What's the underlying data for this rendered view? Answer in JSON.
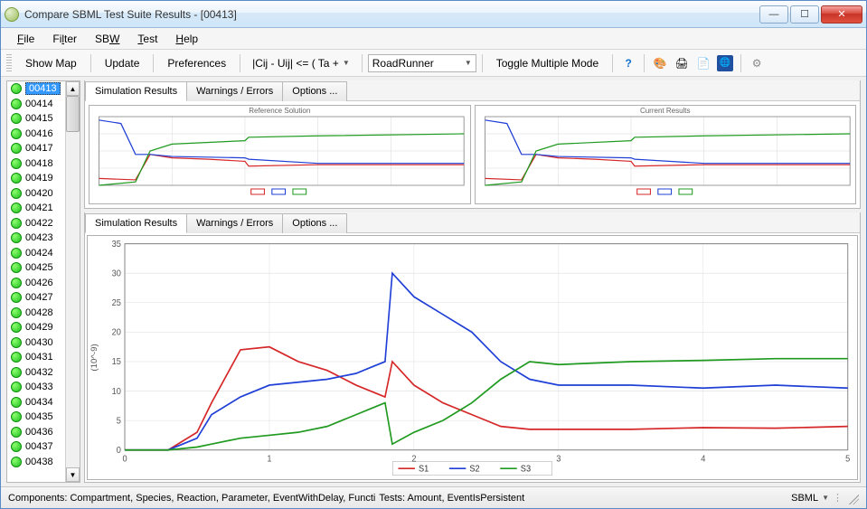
{
  "window": {
    "title": "Compare SBML Test Suite Results   -   [00413]"
  },
  "menu": {
    "items": [
      "File",
      "Filter",
      "SBW",
      "Test",
      "Help"
    ]
  },
  "toolbar": {
    "show_map": "Show Map",
    "update": "Update",
    "preferences": "Preferences",
    "formula": "|Cij - Uij| <= ( Ta +",
    "engine": "RoadRunner",
    "toggle": "Toggle Multiple Mode"
  },
  "sidebar": {
    "selected": "00413",
    "items": [
      "00413",
      "00414",
      "00415",
      "00416",
      "00417",
      "00418",
      "00419",
      "00420",
      "00421",
      "00422",
      "00423",
      "00424",
      "00425",
      "00426",
      "00427",
      "00428",
      "00429",
      "00430",
      "00431",
      "00432",
      "00433",
      "00434",
      "00435",
      "00436",
      "00437",
      "00438"
    ]
  },
  "tabs": {
    "sim": "Simulation Results",
    "warn": "Warnings / Errors",
    "opt": "Options ..."
  },
  "mini_charts": {
    "left_title": "Reference Solution",
    "right_title": "Current Results"
  },
  "status": {
    "components": "Components: Compartment, Species, Reaction, Parameter, EventWithDelay, Functi",
    "tests": "Tests: Amount, EventIsPersistent",
    "engine": "SBML"
  },
  "chart_data": {
    "type": "line",
    "xlabel": "",
    "ylabel": "(10^-9)",
    "xlim": [
      0,
      5
    ],
    "ylim": [
      0,
      35
    ],
    "xticks": [
      0,
      1,
      2,
      3,
      4,
      5
    ],
    "yticks": [
      0,
      5,
      10,
      15,
      20,
      25,
      30,
      35
    ],
    "legend": [
      "S1",
      "S2",
      "S3"
    ],
    "colors": {
      "S1": "#d62728",
      "S2": "#1f3fd6",
      "S3": "#1f9a1f"
    },
    "series": [
      {
        "name": "S1",
        "x": [
          0,
          0.1,
          0.3,
          0.5,
          0.6,
          0.8,
          1.0,
          1.2,
          1.4,
          1.6,
          1.7,
          1.8,
          1.85,
          2.0,
          2.2,
          2.4,
          2.6,
          2.8,
          3.0,
          3.5,
          4.0,
          4.5,
          5.0
        ],
        "y": [
          0,
          0,
          0,
          3,
          8,
          17,
          17.5,
          15,
          13.5,
          11,
          10,
          9,
          15,
          11,
          8,
          6,
          4,
          3.5,
          3.5,
          3.5,
          3.8,
          3.7,
          4.0
        ]
      },
      {
        "name": "S2",
        "x": [
          0,
          0.1,
          0.3,
          0.5,
          0.6,
          0.8,
          1.0,
          1.2,
          1.4,
          1.6,
          1.7,
          1.8,
          1.85,
          2.0,
          2.2,
          2.4,
          2.6,
          2.8,
          3.0,
          3.5,
          4.0,
          4.5,
          5.0
        ],
        "y": [
          0,
          0,
          0,
          2,
          6,
          9,
          11,
          11.5,
          12,
          13,
          14,
          15,
          30,
          26,
          23,
          20,
          15,
          12,
          11,
          11,
          10.5,
          11,
          10.5
        ]
      },
      {
        "name": "S3",
        "x": [
          0,
          0.1,
          0.3,
          0.5,
          0.6,
          0.8,
          1.0,
          1.2,
          1.4,
          1.6,
          1.7,
          1.8,
          1.85,
          2.0,
          2.2,
          2.4,
          2.6,
          2.8,
          3.0,
          3.5,
          4.0,
          4.5,
          5.0
        ],
        "y": [
          0,
          0,
          0,
          0.5,
          1,
          2,
          2.5,
          3,
          4,
          6,
          7,
          8,
          1,
          3,
          5,
          8,
          12,
          15,
          14.5,
          15,
          15.2,
          15.5,
          15.5
        ]
      }
    ],
    "mini": {
      "series": [
        {
          "name": "S1",
          "color": "#d62728",
          "x": [
            0,
            0.5,
            0.7,
            1.0,
            1.5,
            2.0,
            2.05,
            3.0,
            5.0
          ],
          "y": [
            0.9,
            0.92,
            0.55,
            0.6,
            0.62,
            0.65,
            0.72,
            0.7,
            0.7
          ]
        },
        {
          "name": "S2",
          "color": "#1f3fd6",
          "x": [
            0,
            0.3,
            0.5,
            0.7,
            1.0,
            2.0,
            2.05,
            3.0,
            5.0
          ],
          "y": [
            0.05,
            0.1,
            0.55,
            0.55,
            0.58,
            0.6,
            0.62,
            0.68,
            0.68
          ]
        },
        {
          "name": "S3",
          "color": "#1f9a1f",
          "x": [
            0,
            0.5,
            0.7,
            1.0,
            2.0,
            2.05,
            3.0,
            5.0
          ],
          "y": [
            1.0,
            0.95,
            0.5,
            0.4,
            0.35,
            0.3,
            0.28,
            0.25
          ]
        }
      ]
    }
  }
}
